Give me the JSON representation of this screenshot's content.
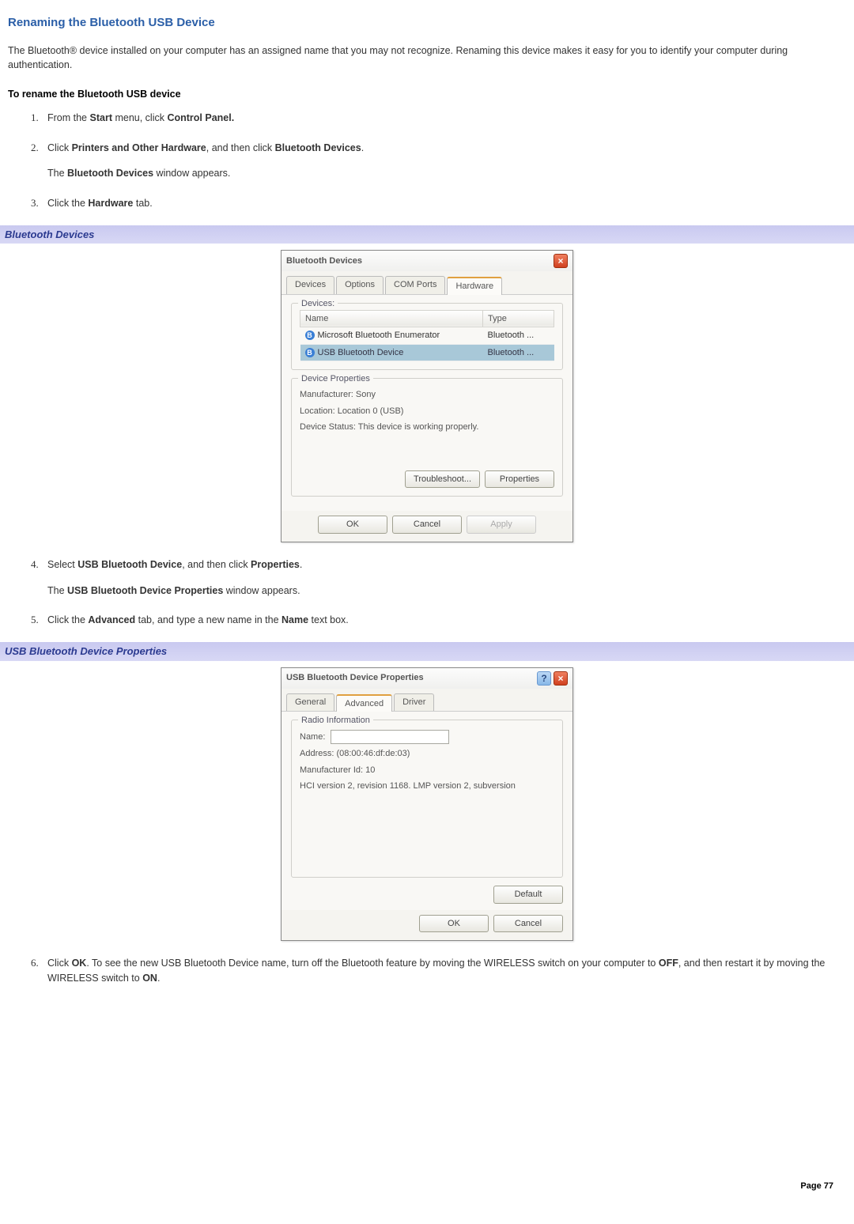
{
  "page": {
    "title": "Renaming the Bluetooth USB Device",
    "intro": "The Bluetooth® device installed on your computer has an assigned name that you may not recognize. Renaming this device makes it easy for you to identify your computer during authentication.",
    "procedure_heading": "To rename the Bluetooth USB device",
    "page_number": "Page 77"
  },
  "steps": {
    "s1_a": "From the ",
    "s1_b": "Start",
    "s1_c": " menu, click ",
    "s1_d": "Control Panel.",
    "s2_a": "Click ",
    "s2_b": "Printers and Other Hardware",
    "s2_c": ", and then click ",
    "s2_d": "Bluetooth Devices",
    "s2_e": ".",
    "s2_sub_a": "The ",
    "s2_sub_b": "Bluetooth Devices",
    "s2_sub_c": " window appears.",
    "s3_a": "Click the ",
    "s3_b": "Hardware",
    "s3_c": " tab.",
    "s4_a": "Select ",
    "s4_b": "USB Bluetooth Device",
    "s4_c": ", and then click ",
    "s4_d": "Properties",
    "s4_e": ".",
    "s4_sub_a": "The ",
    "s4_sub_b": "USB Bluetooth Device Properties",
    "s4_sub_c": " window appears.",
    "s5_a": "Click the ",
    "s5_b": "Advanced",
    "s5_c": " tab, and type a new name in the ",
    "s5_d": "Name",
    "s5_e": " text box.",
    "s6_a": "Click ",
    "s6_b": "OK",
    "s6_c": ". To see the new USB Bluetooth Device name, turn off the Bluetooth feature by moving the WIRELESS switch on your computer to ",
    "s6_d": "OFF",
    "s6_e": ", and then restart it by moving the WIRELESS switch to ",
    "s6_f": "ON",
    "s6_g": "."
  },
  "caption1": "Bluetooth Devices",
  "caption2": "USB Bluetooth Device Properties",
  "dlg1": {
    "title": "Bluetooth Devices",
    "tabs": [
      "Devices",
      "Options",
      "COM Ports",
      "Hardware"
    ],
    "active_tab": 3,
    "group_devices": "Devices:",
    "col_name": "Name",
    "col_type": "Type",
    "row1_name": "Microsoft Bluetooth Enumerator",
    "row1_type": "Bluetooth ...",
    "row2_name": "USB Bluetooth Device",
    "row2_type": "Bluetooth ...",
    "group_props": "Device Properties",
    "manu": "Manufacturer: Sony",
    "loc": "Location: Location 0 (USB)",
    "stat": "Device Status: This device is working properly.",
    "btn_trouble": "Troubleshoot...",
    "btn_props": "Properties",
    "btn_ok": "OK",
    "btn_cancel": "Cancel",
    "btn_apply": "Apply"
  },
  "dlg2": {
    "title": "USB Bluetooth Device Properties",
    "tabs": [
      "General",
      "Advanced",
      "Driver"
    ],
    "active_tab": 1,
    "group_radio": "Radio Information",
    "name_label": "Name:",
    "name_value": "",
    "addr": "Address:    (08:00:46:df:de:03)",
    "mid": "Manufacturer Id:     10",
    "hci": "HCI version 2, revision 1168.  LMP version 2, subversion",
    "btn_default": "Default",
    "btn_ok": "OK",
    "btn_cancel": "Cancel"
  }
}
